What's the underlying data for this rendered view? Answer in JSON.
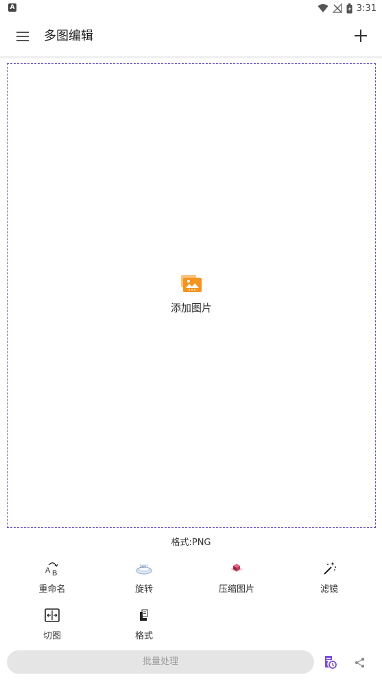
{
  "status_bar": {
    "time": "3:31",
    "app_icon_letter": "A"
  },
  "app_bar": {
    "title": "多图编辑"
  },
  "drop_zone": {
    "add_image_label": "添加图片",
    "border_color": "#6b4fc2",
    "folder_color": "#f59420"
  },
  "format_text": "格式:PNG",
  "tools": {
    "rename": "重命名",
    "rotate": "旋转",
    "compress": "压缩图片",
    "filter": "滤镜",
    "crop": "切图",
    "format": "格式"
  },
  "bottom": {
    "batch_label": "批量处理",
    "accent_color": "#7a4fd6"
  }
}
